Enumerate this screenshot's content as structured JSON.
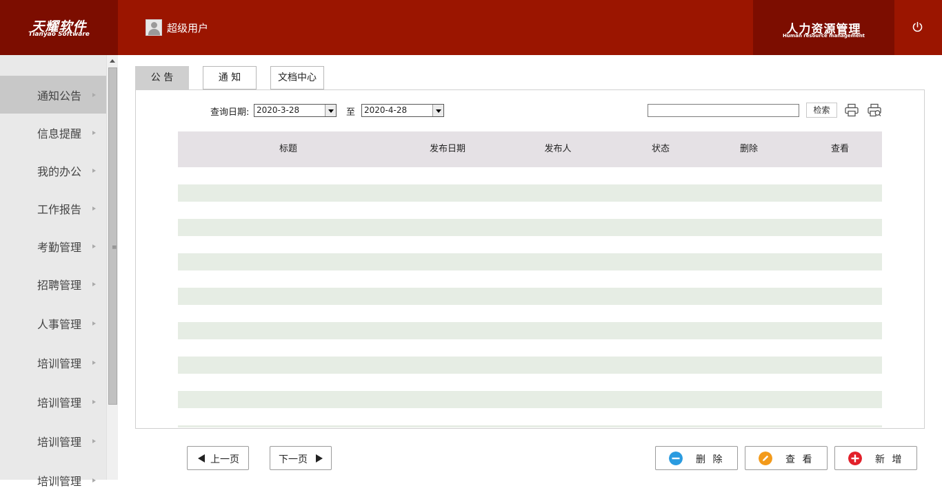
{
  "header": {
    "logo_cn": "天耀软件",
    "logo_en": "Tianyao Software",
    "user_name": "超级用户",
    "system_cn": "人力资源管理",
    "system_en": "Human resource management"
  },
  "sidebar": {
    "items": [
      {
        "label": "通知公告",
        "active": true
      },
      {
        "label": "信息提醒"
      },
      {
        "label": "我的办公"
      },
      {
        "label": "工作报告"
      },
      {
        "label": "考勤管理"
      },
      {
        "label": "招聘管理"
      },
      {
        "label": "人事管理"
      },
      {
        "label": "培训管理"
      },
      {
        "label": "培训管理"
      },
      {
        "label": "培训管理"
      },
      {
        "label": "培训管理"
      }
    ]
  },
  "tabs": [
    {
      "label": "公 告",
      "active": true
    },
    {
      "label": "通 知"
    },
    {
      "label": "文档中心"
    }
  ],
  "filter": {
    "date_label": "查询日期:",
    "start_date": "2020-3-28",
    "to_label": "至",
    "end_date": "2020-4-28",
    "search_value": "",
    "search_button": "检索"
  },
  "table": {
    "columns": [
      "标题",
      "发布日期",
      "发布人",
      "状态",
      "删除",
      "查看"
    ],
    "rows": []
  },
  "pager": {
    "prev": "上一页",
    "next": "下一页"
  },
  "actions": {
    "delete": "删 除",
    "view": "查 看",
    "add": "新 增"
  },
  "colors": {
    "header": "#9b1500",
    "header_dark": "#7c0d00",
    "row_alt": "#e6ede4",
    "table_head": "#e5e1e5"
  }
}
